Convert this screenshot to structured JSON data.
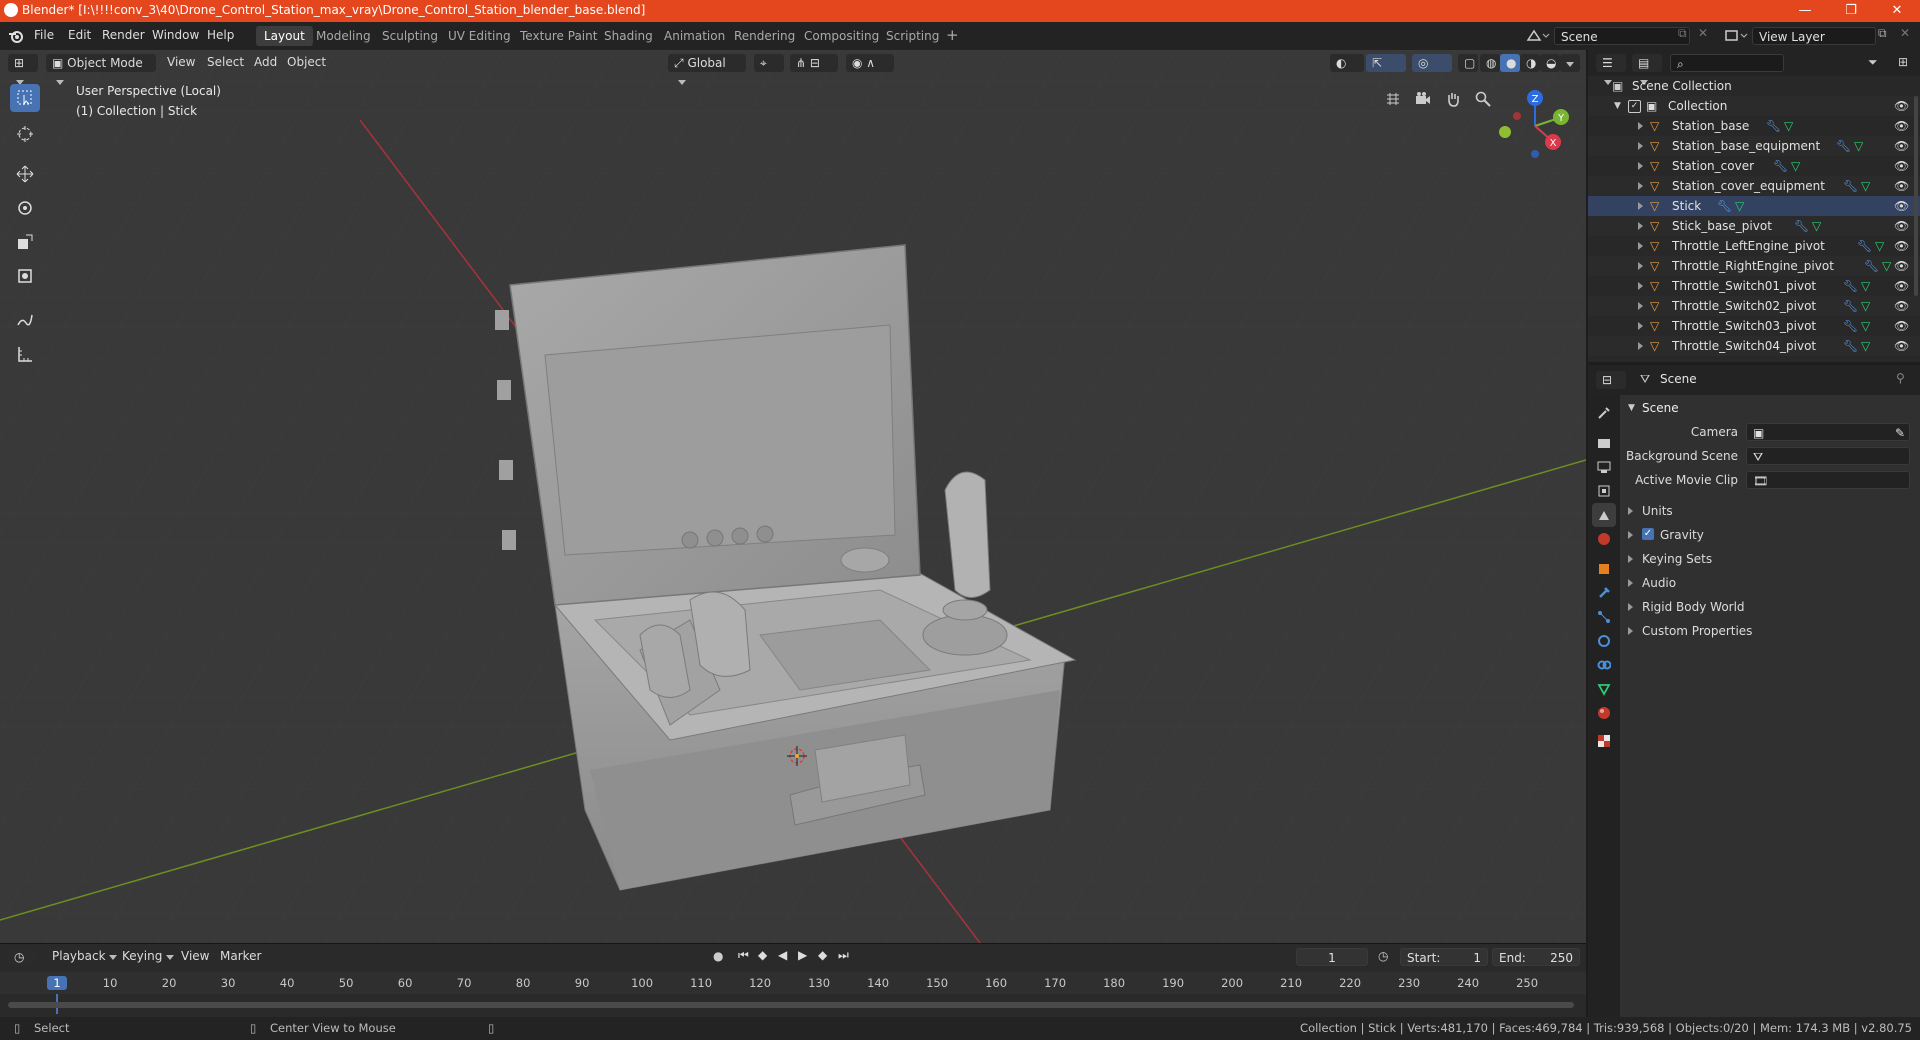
{
  "window": {
    "title": "Blender* [I:\\!!!!conv_3\\40\\Drone_Control_Station_max_vray\\Drone_Control_Station_blender_base.blend]",
    "minimize": "—",
    "maximize": "❐",
    "close": "✕"
  },
  "menu": [
    "File",
    "Edit",
    "Render",
    "Window",
    "Help"
  ],
  "workspaces": [
    "Layout",
    "Modeling",
    "Sculpting",
    "UV Editing",
    "Texture Paint",
    "Shading",
    "Animation",
    "Rendering",
    "Compositing",
    "Scripting"
  ],
  "active_workspace": "Layout",
  "scene_field": "Scene",
  "view_layer_field": "View Layer",
  "viewport": {
    "mode": "Object Mode",
    "menus": [
      "View",
      "Select",
      "Add",
      "Object"
    ],
    "orientation": "Global",
    "overlay_line1": "User Perspective (Local)",
    "overlay_line2": "(1) Collection | Stick",
    "gizmo_labels": {
      "x": "X",
      "y": "Y",
      "z": "Z"
    },
    "colors": {
      "background": "#393939",
      "x_axis": "#a8323c",
      "y_axis": "#6b8f22",
      "active_tool": "#4772b3"
    }
  },
  "outliner": {
    "search_placeholder": "",
    "root": "Scene Collection",
    "collection": "Collection",
    "objects": [
      "Station_base",
      "Station_base_equipment",
      "Station_cover",
      "Station_cover_equipment",
      "Stick",
      "Stick_base_pivot",
      "Throttle_LeftEngine_pivot",
      "Throttle_RightEngine_pivot",
      "Throttle_Switch01_pivot",
      "Throttle_Switch02_pivot",
      "Throttle_Switch03_pivot",
      "Throttle_Switch04_pivot"
    ]
  },
  "properties": {
    "context": "Scene",
    "panel_title": "Scene",
    "fields": [
      {
        "label": "Camera",
        "value": ""
      },
      {
        "label": "Background Scene",
        "value": ""
      },
      {
        "label": "Active Movie Clip",
        "value": ""
      }
    ],
    "subpanels": [
      "Units",
      "Gravity",
      "Keying Sets",
      "Audio",
      "Rigid Body World",
      "Custom Properties"
    ],
    "gravity_checked": true
  },
  "timeline": {
    "menus": [
      "Playback",
      "Keying",
      "View",
      "Marker"
    ],
    "current_frame": "1",
    "start_label": "Start:",
    "start": "1",
    "end_label": "End:",
    "end": "250",
    "ruler": [
      "1",
      "10",
      "20",
      "30",
      "40",
      "50",
      "60",
      "70",
      "80",
      "90",
      "100",
      "110",
      "120",
      "130",
      "140",
      "150",
      "160",
      "170",
      "180",
      "190",
      "200",
      "210",
      "220",
      "230",
      "240",
      "250"
    ]
  },
  "status": {
    "left_action": "Select",
    "middle_action": "Center View to Mouse",
    "stats": "Collection | Stick | Verts:481,170 | Faces:469,784 | Tris:939,568 | Objects:0/20 | Mem: 174.3 MB | v2.80.75"
  }
}
